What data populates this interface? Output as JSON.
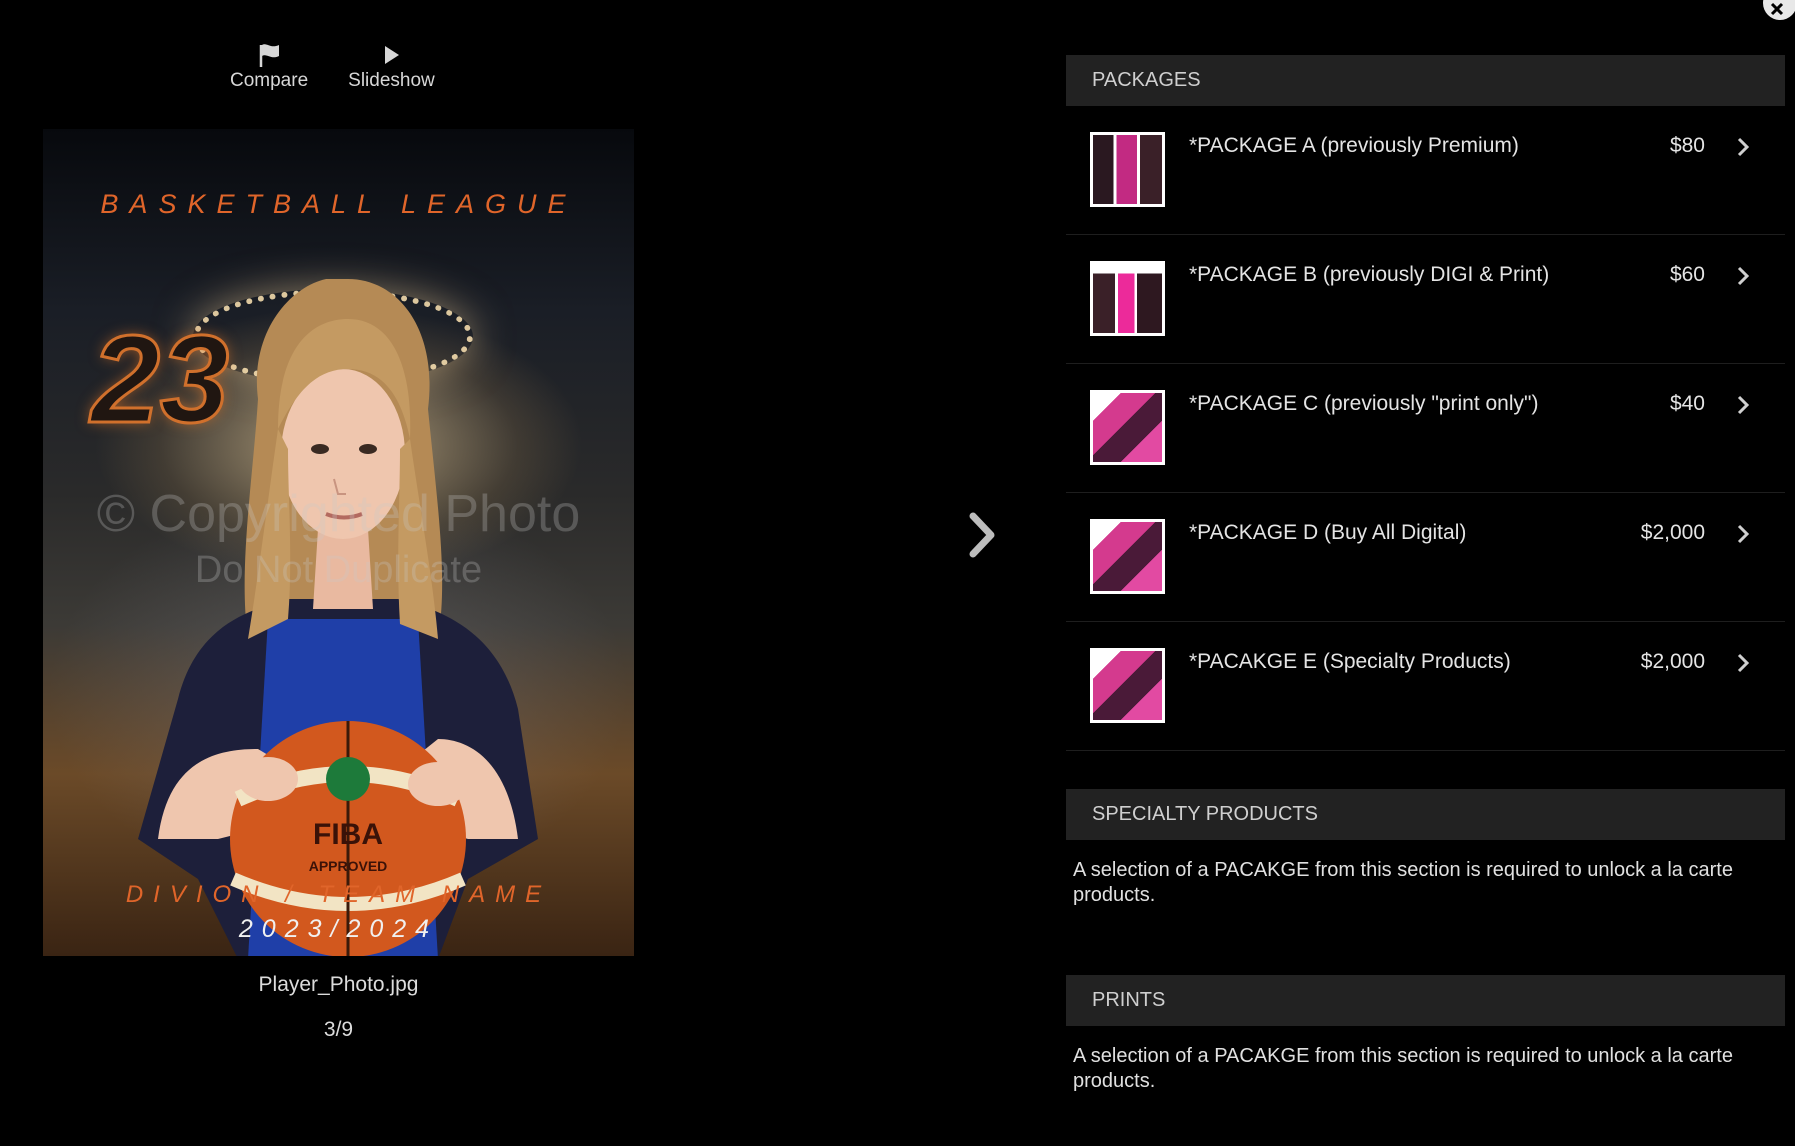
{
  "toolbar": {
    "compare_label": "Compare",
    "slideshow_label": "Slideshow"
  },
  "photo": {
    "league_text": "BASKETBALL LEAGUE",
    "jersey_number": "23",
    "watermark_line1": "© Copyrighted Photo",
    "watermark_line2": "Do Not Duplicate",
    "division_text": "DIVION / TEAM NAME",
    "season_text": "2023/2024",
    "filename": "Player_Photo.jpg",
    "counter": "3/9"
  },
  "packages_section": {
    "title": "PACKAGES",
    "items": [
      {
        "name": "*PACKAGE A (previously Premium)",
        "price": "$80"
      },
      {
        "name": "*PACKAGE B (previously DIGI & Print)",
        "price": "$60"
      },
      {
        "name": "*PACKAGE C (previously \"print only\")",
        "price": "$40"
      },
      {
        "name": "*PACKAGE D (Buy All Digital)",
        "price": "$2,000"
      },
      {
        "name": "*PACAKGE E (Specialty Products)",
        "price": "$2,000"
      }
    ]
  },
  "specialty_section": {
    "title": "SPECIALTY PRODUCTS",
    "text": "A selection of a PACAKGE from this section is required to unlock a la carte products."
  },
  "prints_section": {
    "title": "PRINTS",
    "text": "A selection of a PACAKGE from this section is required to unlock a la carte products."
  },
  "icons": {
    "close": "close-icon",
    "compare": "flag-icon",
    "slideshow": "play-icon",
    "next": "chevron-right-icon",
    "row": "chevron-right-icon"
  },
  "colors": {
    "background": "#000000",
    "section_header_bg": "#222222",
    "accent_orange": "#e0652a"
  }
}
